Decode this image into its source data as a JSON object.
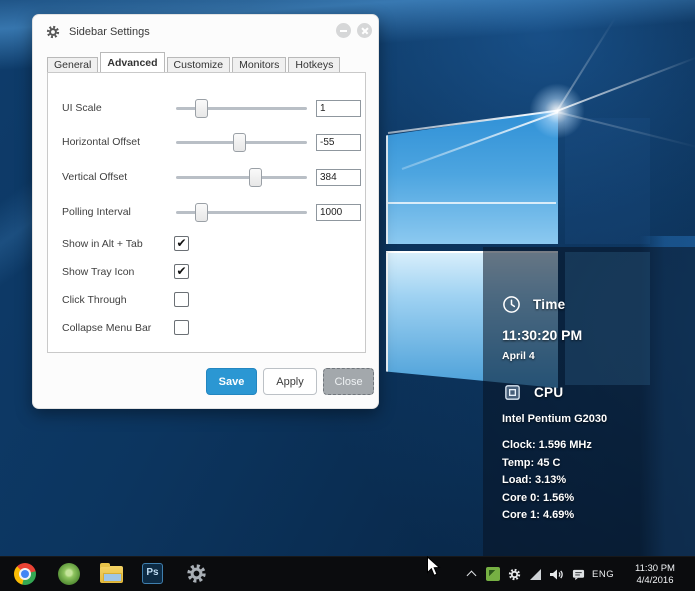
{
  "dialog": {
    "title": "Sidebar Settings",
    "accent_color": "#2b97d3",
    "tabs": [
      {
        "label": "General",
        "active": false
      },
      {
        "label": "Advanced",
        "active": true
      },
      {
        "label": "Customize",
        "active": false
      },
      {
        "label": "Monitors",
        "active": false
      },
      {
        "label": "Hotkeys",
        "active": false
      }
    ],
    "sliders": [
      {
        "label": "UI Scale",
        "value": "1",
        "percent": 19
      },
      {
        "label": "Horizontal Offset",
        "value": "-55",
        "percent": 48
      },
      {
        "label": "Vertical Offset",
        "value": "384",
        "percent": 60
      },
      {
        "label": "Polling Interval",
        "value": "1000",
        "percent": 19
      }
    ],
    "checkboxes": [
      {
        "label": "Show in Alt + Tab",
        "checked": true
      },
      {
        "label": "Show Tray Icon",
        "checked": true
      },
      {
        "label": "Click Through",
        "checked": false
      },
      {
        "label": "Collapse Menu Bar",
        "checked": false
      }
    ],
    "buttons": {
      "save": "Save",
      "apply": "Apply",
      "close": "Close"
    }
  },
  "sidebar": {
    "time": {
      "title": "Time",
      "value": "11:30:20 PM",
      "date": "April 4"
    },
    "cpu": {
      "title": "CPU",
      "processor": "Intel Pentium G2030",
      "stats": [
        "Clock: 1.596 MHz",
        "Temp: 45 C",
        "Load: 3.13%",
        "Core 0: 1.56%",
        "Core 1: 4.69%"
      ]
    }
  },
  "taskbar": {
    "photoshop_label": "Ps",
    "tray": {
      "language": "ENG",
      "time": "11:30 PM",
      "date": "4/4/2016"
    }
  }
}
